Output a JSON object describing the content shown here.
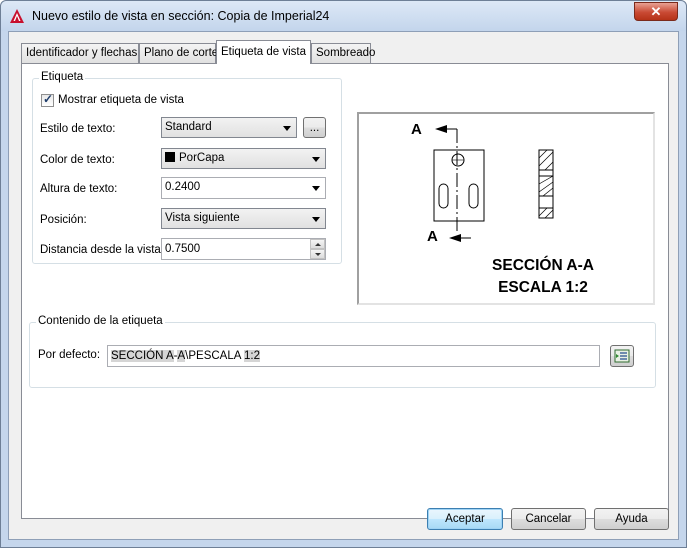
{
  "window": {
    "title": "Nuevo estilo de vista en sección: Copia de Imperial24",
    "close_label": "✕"
  },
  "tabs": [
    {
      "label": "Identificador y flechas"
    },
    {
      "label": "Plano de corte"
    },
    {
      "label": "Etiqueta de vista"
    },
    {
      "label": "Sombreado"
    }
  ],
  "active_tab": "Etiqueta de vista",
  "etiqueta": {
    "group_title": "Etiqueta",
    "show_label": {
      "label": "Mostrar etiqueta de vista",
      "checked": true
    },
    "text_style": {
      "label": "Estilo de texto:",
      "value": "Standard",
      "browse_label": "..."
    },
    "text_color": {
      "label": "Color de texto:",
      "value": "PorCapa",
      "swatch": "#000000"
    },
    "text_height": {
      "label": "Altura de texto:",
      "value": "0.2400"
    },
    "position": {
      "label": "Posición:",
      "value": "Vista siguiente"
    },
    "distance": {
      "label": "Distancia desde la vista:",
      "value": "0.7500"
    }
  },
  "preview": {
    "arrow_top_label": "A",
    "arrow_bottom_label": "A",
    "caption_line1": "SECCIÓN A-A",
    "caption_line2": "ESCALA 1:2"
  },
  "contenido": {
    "group_title": "Contenido de la etiqueta",
    "default_label": "Por defecto:",
    "default_parts": [
      "SECCIÓN ",
      "A",
      "-",
      "A",
      "\\P",
      "ESCALA ",
      "1:2"
    ],
    "field_button_icon": "field-insert-icon"
  },
  "buttons": {
    "ok": "Aceptar",
    "cancel": "Cancelar",
    "help": "Ayuda"
  }
}
